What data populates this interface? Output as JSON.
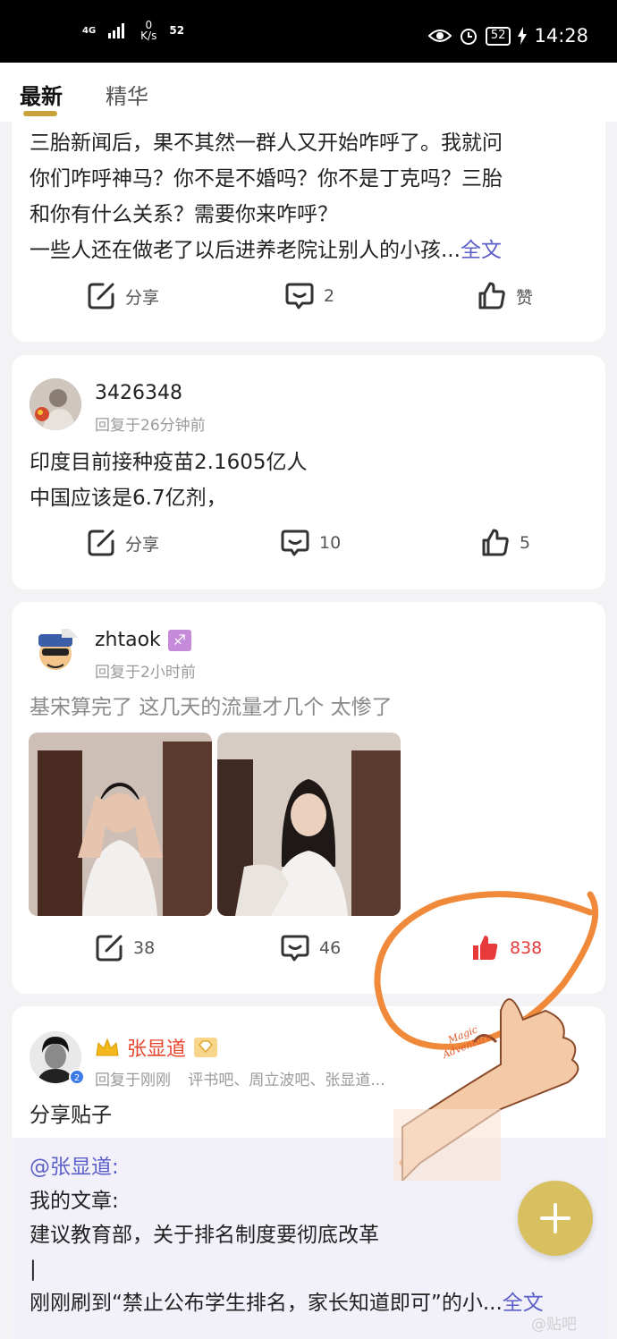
{
  "status_bar": {
    "signal_label": "4G",
    "speed_value": "0",
    "speed_unit": "K/s",
    "extra": "52",
    "battery": "52",
    "time": "14:28"
  },
  "tabs": [
    {
      "label": "最新",
      "active": true
    },
    {
      "label": "精华",
      "active": false
    }
  ],
  "posts": [
    {
      "text_lines": [
        "三胎新闻后，果不其然一群人又开始咋呼了。我就问",
        "你们咋呼神马？你不是不婚吗？你不是丁克吗？三胎",
        "和你有什么关系？需要你来咋呼？",
        "一些人还在做老了以后进养老院让别人的小孩..."
      ],
      "more_label": "全文",
      "actions": {
        "share": "分享",
        "comments": "2",
        "like": "赞"
      }
    },
    {
      "username": "3426348",
      "meta": "回复于26分钟前",
      "text_lines": [
        "印度目前接种疫苗2.1605亿人",
        "中国应该是6.7亿剂，"
      ],
      "actions": {
        "share": "分享",
        "comments": "10",
        "like": "5"
      }
    },
    {
      "username": "zhtaok",
      "zodiac": "♐",
      "meta": "回复于2小时前",
      "text": "基宋算完了 这几天的流量才几个 太惨了",
      "actions": {
        "share": "38",
        "comments": "46",
        "like": "838"
      },
      "like_color": "#e83a3a"
    },
    {
      "username": "张显道",
      "meta": "回复于刚刚",
      "forums": "评书吧、周立波吧、张显道...",
      "text": "分享贴子",
      "quote": {
        "mention": "@张显道:",
        "lines": [
          "我的文章:",
          "建议教育部，关于排名制度要彻底改革",
          "|",
          "刚刚刷到“禁止公布学生排名，家长知道即可”的小..."
        ],
        "more_label": "全文"
      }
    }
  ],
  "sticker_text": "Magic Adventure",
  "fab_icon": "plus-icon",
  "watermark": "@贴吧",
  "colors": {
    "accent": "#c8a23a",
    "link": "#5b5fc7",
    "liked": "#e83a3a",
    "annotation": "#f08a3a"
  }
}
